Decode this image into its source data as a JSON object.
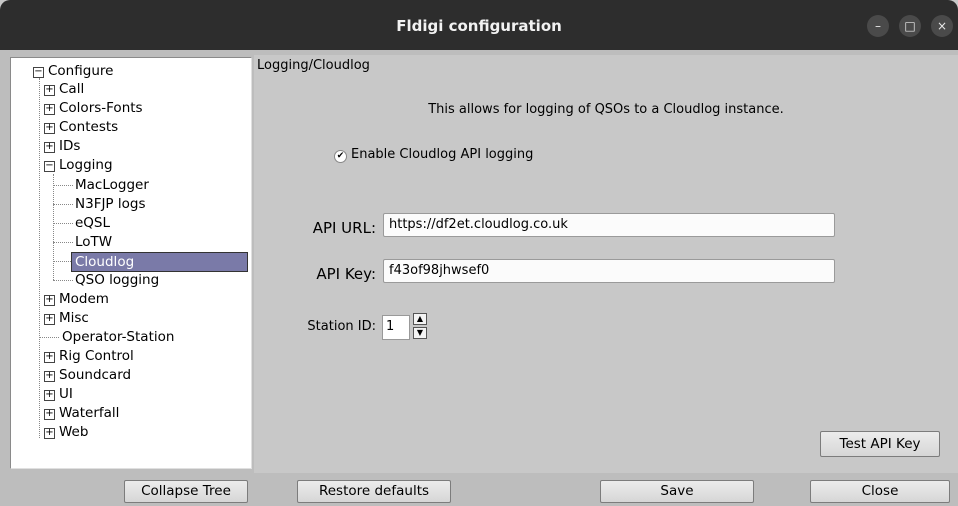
{
  "window": {
    "title": "Fldigi configuration",
    "controls": {
      "minimize": "–",
      "maximize": "□",
      "close": "×"
    }
  },
  "tree": {
    "root": "Configure",
    "items": [
      {
        "label": "Call",
        "expandable": true
      },
      {
        "label": "Colors-Fonts",
        "expandable": true
      },
      {
        "label": "Contests",
        "expandable": true
      },
      {
        "label": "IDs",
        "expandable": true
      },
      {
        "label": "Logging",
        "expandable": true,
        "expanded": true
      },
      {
        "label": "MacLogger",
        "child": true
      },
      {
        "label": "N3FJP logs",
        "child": true
      },
      {
        "label": "eQSL",
        "child": true
      },
      {
        "label": "LoTW",
        "child": true
      },
      {
        "label": "Cloudlog",
        "child": true,
        "selected": true
      },
      {
        "label": "QSO logging",
        "child": true
      },
      {
        "label": "Modem",
        "expandable": true
      },
      {
        "label": "Misc",
        "expandable": true
      },
      {
        "label": "Operator-Station",
        "expandable": false
      },
      {
        "label": "Rig Control",
        "expandable": true
      },
      {
        "label": "Soundcard",
        "expandable": true
      },
      {
        "label": "UI",
        "expandable": true
      },
      {
        "label": "Waterfall",
        "expandable": true
      },
      {
        "label": "Web",
        "expandable": true
      }
    ]
  },
  "panel": {
    "breadcrumb": "Logging/Cloudlog",
    "description": "This allows for logging of QSOs to a Cloudlog instance.",
    "enable_label": "Enable Cloudlog API logging",
    "enable_checked": true,
    "api_url_label": "API URL:",
    "api_url_value": "https://df2et.cloudlog.co.uk",
    "api_key_label": "API Key:",
    "api_key_value": "f43of98jhwsef0",
    "station_id_label": "Station ID:",
    "station_id_value": "1",
    "test_button": "Test API Key"
  },
  "footer": {
    "collapse": "Collapse Tree",
    "restore": "Restore defaults",
    "save": "Save",
    "close": "Close"
  },
  "colors": {
    "titlebar": "#2d2d2d",
    "selection": "#7a7aa8",
    "panel": "#c8c8c8"
  }
}
